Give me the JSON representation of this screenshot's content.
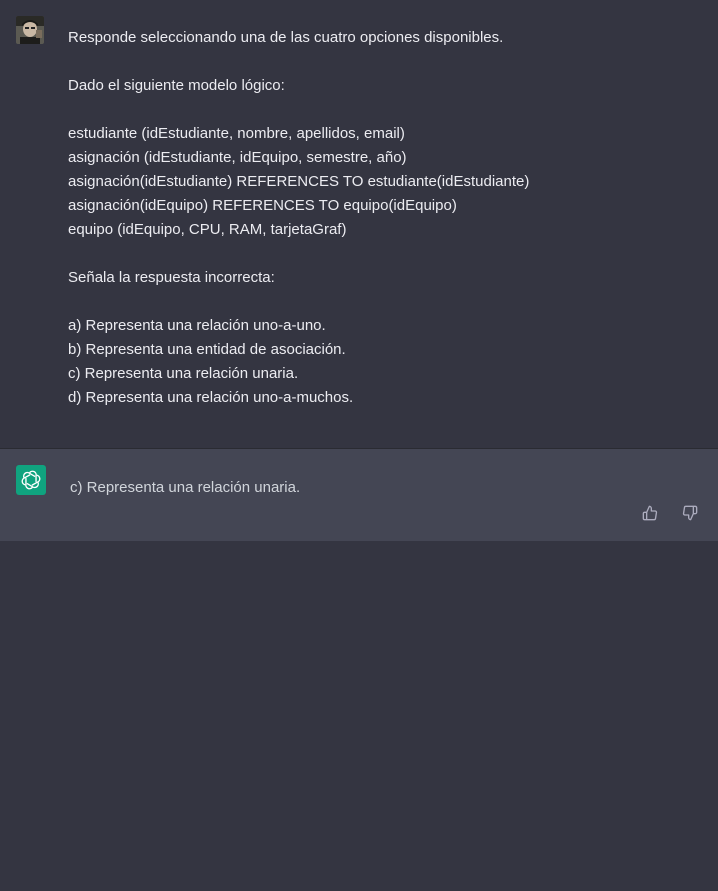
{
  "conversation": {
    "user_message": {
      "lines": [
        "Responde seleccionando una de las cuatro opciones disponibles.",
        "",
        "Dado el siguiente modelo lógico:",
        "",
        "estudiante (idEstudiante, nombre, apellidos, email)",
        "asignación (idEstudiante, idEquipo, semestre, año)",
        "asignación(idEstudiante) REFERENCES TO estudiante(idEstudiante)",
        "asignación(idEquipo) REFERENCES TO equipo(idEquipo)",
        "equipo (idEquipo, CPU, RAM, tarjetaGraf)",
        "",
        "Señala la respuesta incorrecta:",
        "",
        "a) Representa una relación uno-a-uno.",
        "b) Representa una entidad de asociación.",
        "c) Representa una relación unaria.",
        "d) Representa una relación uno-a-muchos."
      ]
    },
    "assistant_message": {
      "text": "c) Representa una relación unaria.",
      "avatar_icon": "openai-logo-icon",
      "feedback_icons": [
        "thumbs-up-icon",
        "thumbs-down-icon"
      ]
    }
  },
  "colors": {
    "background": "#343541",
    "assistant_background": "#444654",
    "assistant_avatar": "#10a37f",
    "text": "#ececf1"
  }
}
